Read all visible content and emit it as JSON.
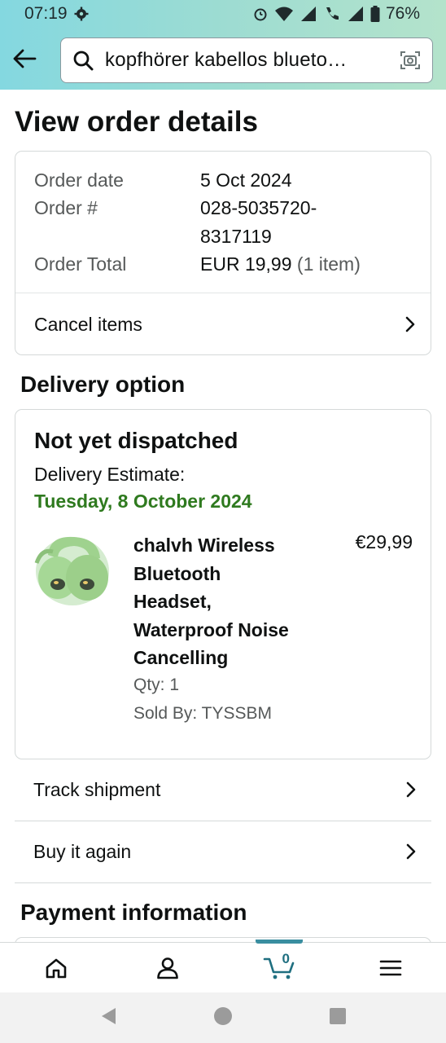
{
  "status_bar": {
    "time": "07:19",
    "battery": "76%"
  },
  "search": {
    "query": "kopfhörer kabellos blueto…"
  },
  "page": {
    "title": "View order details"
  },
  "order_summary": {
    "order_date_label": "Order date",
    "order_date_value": "5 Oct 2024",
    "order_number_label": "Order #",
    "order_number_line1": "028-5035720-",
    "order_number_line2": "8317119",
    "order_total_label": "Order Total",
    "order_total_value": "EUR 19,99",
    "order_total_items": "(1 item)",
    "cancel_label": "Cancel items"
  },
  "delivery": {
    "section_title": "Delivery option",
    "status": "Not yet dispatched",
    "estimate_label": "Delivery Estimate:",
    "estimate_date": "Tuesday, 8 October 2024",
    "estimate_color": "#2f7a1f",
    "product": {
      "name_lines": [
        "chalvh Wireless",
        "Bluetooth",
        "Headset,",
        "Waterproof Noise",
        "Cancelling"
      ],
      "price": "€29,99",
      "qty": "Qty: 1",
      "sold_by": "Sold By: TYSSBM",
      "image_icon": "green-earbuds-image"
    }
  },
  "actions": {
    "track_label": "Track shipment",
    "buy_again_label": "Buy it again"
  },
  "payment": {
    "section_title": "Payment information"
  },
  "bottom_nav": {
    "cart_count": "0",
    "accent_color": "#3a8ea0"
  }
}
